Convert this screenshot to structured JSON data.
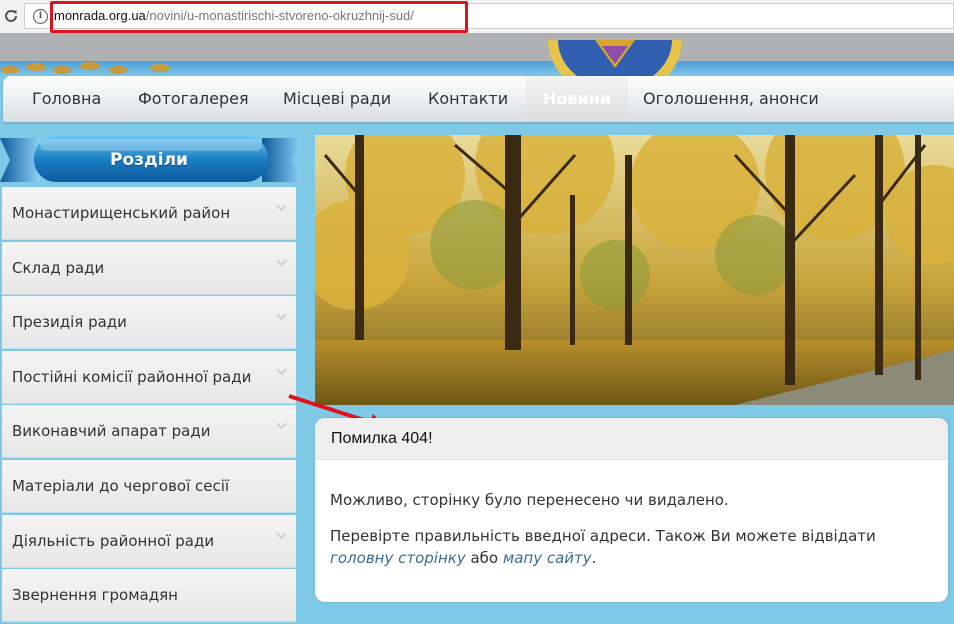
{
  "browser": {
    "url_host": "monrada.org.ua",
    "url_path": "/novini/u-monastirischi-stvoreno-okruzhnij-sud/"
  },
  "nav": {
    "items": [
      {
        "label": "Головна"
      },
      {
        "label": "Фотогалерея"
      },
      {
        "label": "Місцеві ради"
      },
      {
        "label": "Контакти"
      },
      {
        "label": "Новини"
      },
      {
        "label": "Оголошення, анонси"
      }
    ],
    "active_index": 4
  },
  "sidebar": {
    "title": "Розділи",
    "items": [
      {
        "label": "Монастирищенський район",
        "has_submenu": true
      },
      {
        "label": "Склад ради",
        "has_submenu": true
      },
      {
        "label": "Президія ради",
        "has_submenu": true
      },
      {
        "label": "Постійні комісії районної ради",
        "has_submenu": true
      },
      {
        "label": "Виконавчий апарат ради",
        "has_submenu": true
      },
      {
        "label": "Матеріали до чергової сесії",
        "has_submenu": false
      },
      {
        "label": "Діяльність районної ради",
        "has_submenu": true
      },
      {
        "label": "Звернення громадян",
        "has_submenu": false
      }
    ]
  },
  "error": {
    "title": "Помилка 404!",
    "line1": "Можливо, сторінку було перенесено чи видалено.",
    "line2_start": "Перевірте правильність введної адреси. Також Ви можете відвідати ",
    "home_link": "головну сторінку",
    "line2_mid": " або ",
    "sitemap_link": "мапу сайту",
    "line2_end": "."
  },
  "colors": {
    "page_bg": "#7fc8e6",
    "annotation_red": "#e0121b",
    "sidebar_header_blue": "#1b7fc4",
    "link": "#3a6d8e"
  }
}
